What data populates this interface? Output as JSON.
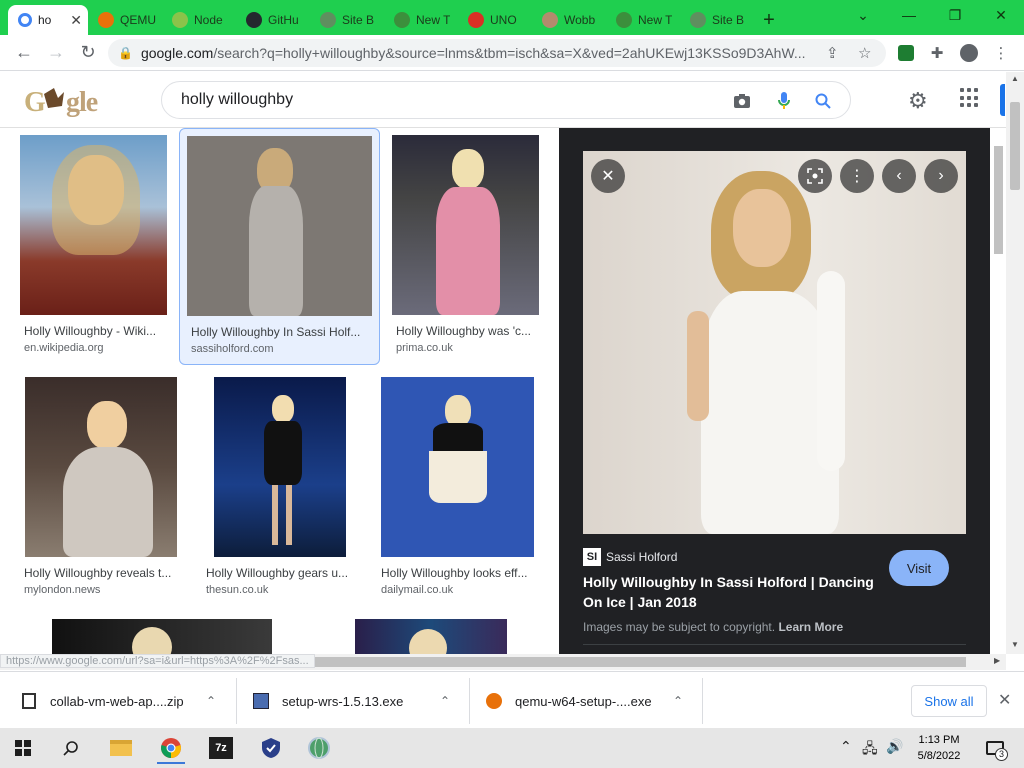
{
  "browser": {
    "tabs": [
      {
        "label": "ho",
        "favicon_color": "#4285f4",
        "active": true
      },
      {
        "label": "QEMU",
        "favicon_color": "#e8710a"
      },
      {
        "label": "Node",
        "favicon_color": "#8bc34a"
      },
      {
        "label": "GitHu",
        "favicon_color": "#24292e"
      },
      {
        "label": "Site B",
        "favicon_color": "#5f8f5f"
      },
      {
        "label": "New T",
        "favicon_color": "#3c8f3c"
      },
      {
        "label": "UNO",
        "favicon_color": "#d93025"
      },
      {
        "label": "Wobb",
        "favicon_color": "#b38b6d"
      },
      {
        "label": "New T",
        "favicon_color": "#3c8f3c"
      },
      {
        "label": "Site B",
        "favicon_color": "#5f8f5f"
      }
    ],
    "new_tab": "+",
    "window_controls": {
      "dropdown": "⌄",
      "minimize": "—",
      "restore": "❐",
      "close": "✕"
    },
    "nav": {
      "back": "←",
      "forward": "→",
      "reload": "↻"
    },
    "url_host": "google.com",
    "url_path": "/search?q=holly+willoughby&source=lnms&tbm=isch&sa=X&ved=2ahUKEwj13KSSo9D3AhW..."
  },
  "google": {
    "logo_text": "Google",
    "search_value": "holly willoughby"
  },
  "results": [
    {
      "caption": "Holly Willoughby - Wiki...",
      "source": "en.wikipedia.org"
    },
    {
      "caption": "Holly Willoughby In Sassi Holf...",
      "source": "sassiholford.com"
    },
    {
      "caption": "Holly Willoughby was 'c...",
      "source": "prima.co.uk"
    },
    {
      "caption": "Holly Willoughby reveals t...",
      "source": "mylondon.news"
    },
    {
      "caption": "Holly Willoughby gears u...",
      "source": "thesun.co.uk"
    },
    {
      "caption": "Holly Willoughby looks eff...",
      "source": "dailymail.co.uk"
    }
  ],
  "preview": {
    "site_logo": "SI",
    "site_name": "Sassi Holford",
    "title": "Holly Willoughby In Sassi Holford | Dancing On Ice | Jan 2018",
    "visit_label": "Visit",
    "copyright_text": "Images may be subject to copyright.",
    "learn_more": "Learn More"
  },
  "status_url": "https://www.google.com/url?sa=i&url=https%3A%2F%2Fsas...",
  "downloads": {
    "items": [
      {
        "name": "collab-vm-web-ap....zip"
      },
      {
        "name": "setup-wrs-1.5.13.exe"
      },
      {
        "name": "qemu-w64-setup-....exe"
      }
    ],
    "show_all": "Show all"
  },
  "taskbar": {
    "time": "1:13 PM",
    "date": "5/8/2022",
    "notification_count": "3",
    "sevenzip_label": "7z"
  }
}
